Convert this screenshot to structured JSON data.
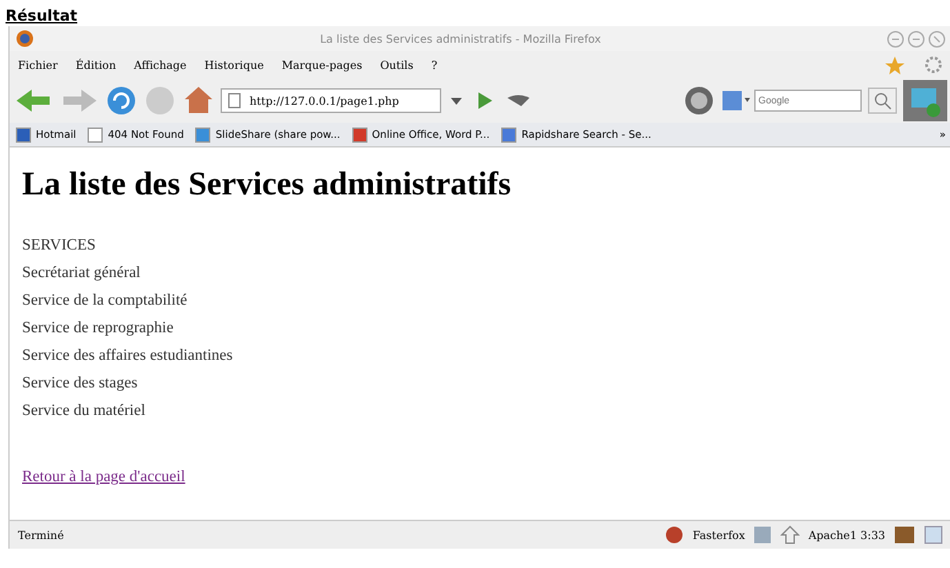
{
  "caption": "Résultat",
  "window": {
    "title": "La liste des Services administratifs - Mozilla Firefox"
  },
  "menu": [
    "Fichier",
    "Édition",
    "Affichage",
    "Historique",
    "Marque-pages",
    "Outils",
    "?"
  ],
  "address": {
    "value": "http://127.0.0.1/page1.php"
  },
  "search": {
    "placeholder": "Google"
  },
  "bookmarks": [
    "Hotmail",
    "404 Not Found",
    "SlideShare (share pow...",
    "Online Office, Word P...",
    "Rapidshare Search - Se..."
  ],
  "bookmarks_more": "»",
  "page": {
    "heading": "La liste des Services administratifs",
    "list_title": "SERVICES",
    "services": [
      "Secrétariat général",
      "Service de la comptabilité",
      "Service de reprographie",
      "Service des affaires estudiantines",
      "Service des stages",
      "Service du matériel"
    ],
    "link": "Retour à la page d'accueil"
  },
  "status_bar": {
    "text": "Terminé",
    "addon": "Fasterfox",
    "server": "Apache1 3:33"
  }
}
